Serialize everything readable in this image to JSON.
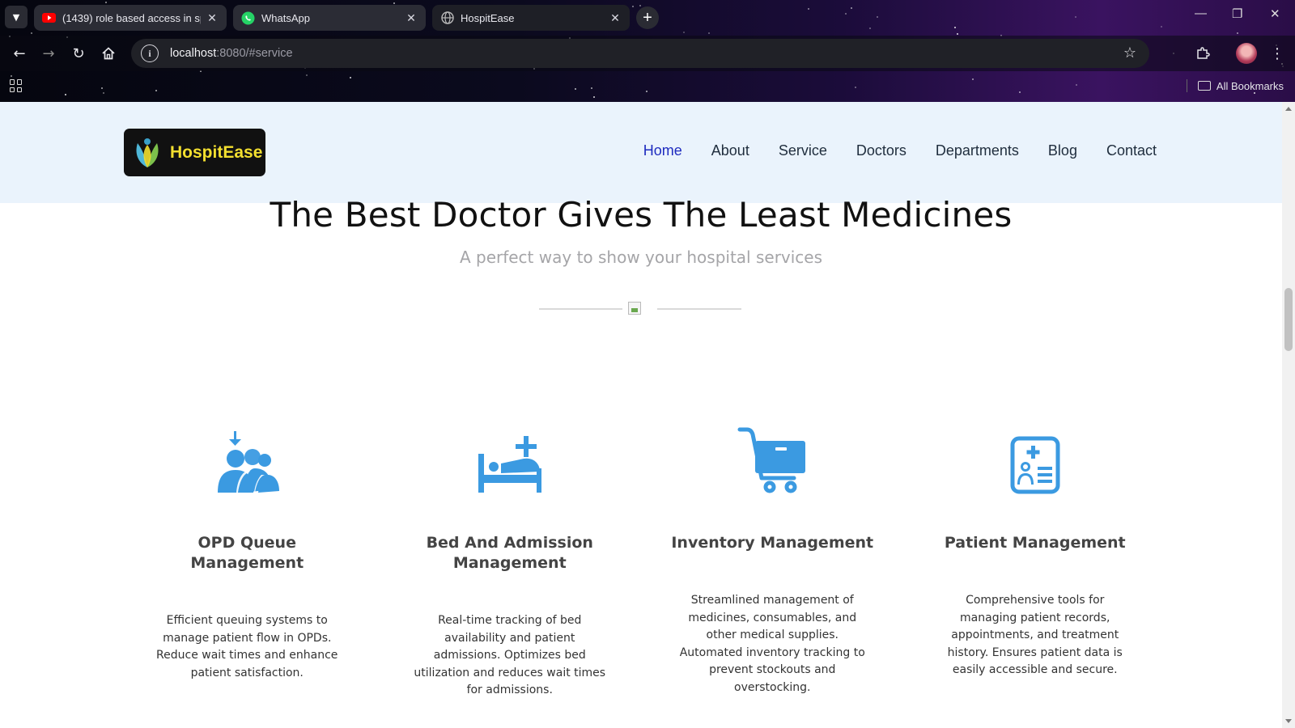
{
  "browser": {
    "tabs": [
      {
        "title": "(1439) role based access in spri",
        "favicon": "youtube-icon",
        "active": false
      },
      {
        "title": "WhatsApp",
        "favicon": "whatsapp-icon",
        "active": false
      },
      {
        "title": "HospitEase",
        "favicon": "globe-icon",
        "active": true
      }
    ],
    "url_host": "localhost",
    "url_rest": ":8080/#service",
    "bookmarks_label": "All Bookmarks"
  },
  "site": {
    "logo_text": "HospitEase",
    "nav": [
      {
        "label": "Home",
        "active": true
      },
      {
        "label": "About",
        "active": false
      },
      {
        "label": "Service",
        "active": false
      },
      {
        "label": "Doctors",
        "active": false
      },
      {
        "label": "Departments",
        "active": false
      },
      {
        "label": "Blog",
        "active": false
      },
      {
        "label": "Contact",
        "active": false
      }
    ],
    "hero_title": "The Best Doctor Gives The Least Medicines",
    "hero_subtitle": "A perfect way to show your hospital services",
    "services": [
      {
        "title": "OPD Queue Management",
        "icon": "opd-queue-icon",
        "description": "Efficient queuing systems to manage patient flow in OPDs. Reduce wait times and enhance patient satisfaction."
      },
      {
        "title": "Bed And Admission Management",
        "icon": "hospital-bed-icon",
        "description": "Real-time tracking of bed availability and patient admissions. Optimizes bed utilization and reduces wait times for admissions."
      },
      {
        "title": "Inventory Management",
        "icon": "shopping-cart-icon",
        "description": "Streamlined management of medicines, consumables, and other medical supplies. Automated inventory tracking to prevent stockouts and overstocking."
      },
      {
        "title": "Patient Management",
        "icon": "patient-record-icon",
        "description": "Comprehensive tools for managing patient records, appointments, and treatment history. Ensures patient data is easily accessible and secure."
      }
    ]
  },
  "colors": {
    "accent_blue": "#3b9ae1",
    "nav_active": "#1e2bbf",
    "header_bg": "#eaf3fc",
    "logo_yellow": "#f3df2f"
  }
}
